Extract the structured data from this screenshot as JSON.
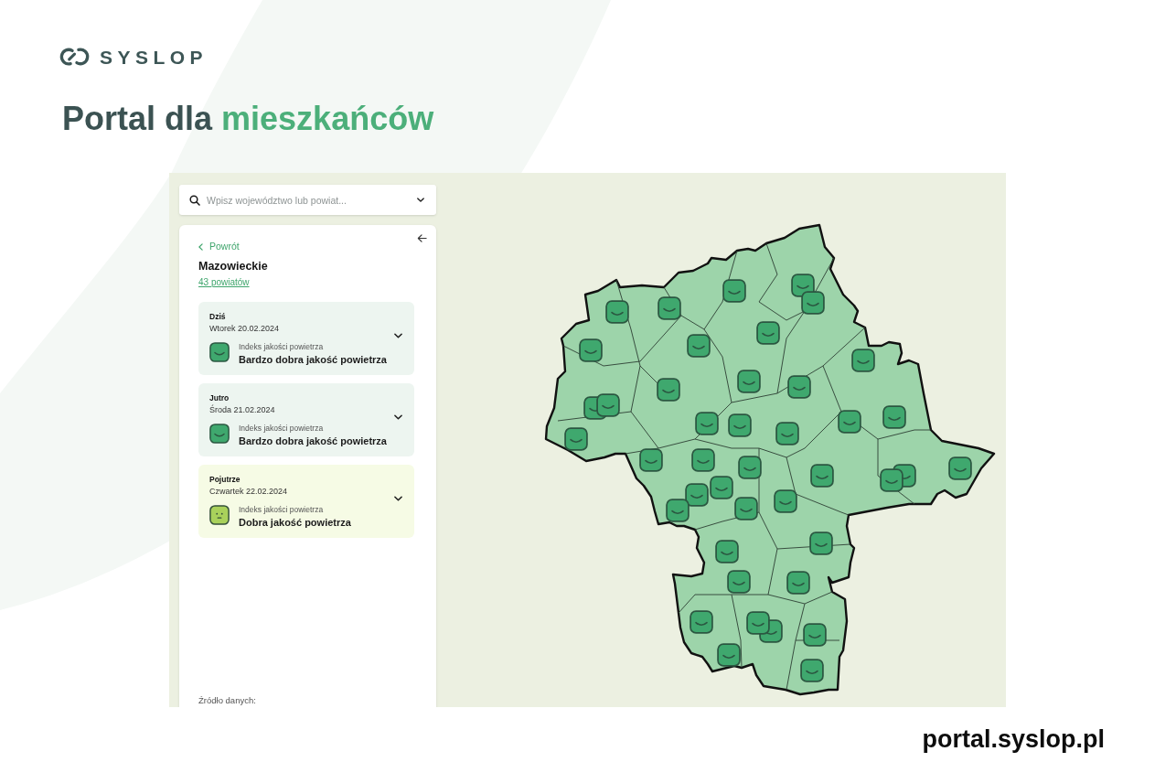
{
  "brand": {
    "name": "SYSLOP"
  },
  "headline": {
    "text": "Portal dla",
    "highlight": "mieszkańców"
  },
  "app": {
    "search": {
      "placeholder": "Wpisz województwo lub powiat..."
    },
    "panel": {
      "back_link": "Powrót",
      "region": "Mazowieckie",
      "districts_link": "43 powiatów",
      "forecasts": [
        {
          "day": "Dziś",
          "date": "Wtorek 20.02.2024",
          "index_label": "Indeks jakości powietrza",
          "quality": "Bardzo dobra jakość powietrza",
          "kind": "very_good",
          "expanded": false
        },
        {
          "day": "Jutro",
          "date": "Środa 21.02.2024",
          "index_label": "Indeks jakości powietrza",
          "quality": "Bardzo dobra jakość powietrza",
          "kind": "very_good",
          "expanded": false
        },
        {
          "day": "Pojutrze",
          "date": "Czwartek 22.02.2024",
          "index_label": "Indeks jakości powietrza",
          "quality": "Dobra jakość powietrza",
          "kind": "good",
          "expanded": false
        }
      ],
      "source_label": "Źródło danych:"
    },
    "map": {
      "markers": [
        {
          "kind": "very_good"
        },
        {
          "kind": "very_good"
        },
        {
          "kind": "very_good"
        },
        {
          "kind": "very_good"
        },
        {
          "kind": "very_good"
        },
        {
          "kind": "very_good"
        },
        {
          "kind": "very_good"
        },
        {
          "kind": "very_good"
        },
        {
          "kind": "very_good"
        },
        {
          "kind": "very_good"
        },
        {
          "kind": "very_good"
        },
        {
          "kind": "very_good"
        },
        {
          "kind": "very_good"
        },
        {
          "kind": "very_good"
        },
        {
          "kind": "very_good"
        },
        {
          "kind": "very_good"
        },
        {
          "kind": "very_good"
        },
        {
          "kind": "very_good"
        },
        {
          "kind": "very_good"
        },
        {
          "kind": "very_good"
        },
        {
          "kind": "very_good"
        },
        {
          "kind": "very_good"
        },
        {
          "kind": "very_good"
        },
        {
          "kind": "very_good"
        },
        {
          "kind": "very_good"
        },
        {
          "kind": "very_good"
        },
        {
          "kind": "very_good"
        },
        {
          "kind": "very_good"
        },
        {
          "kind": "very_good"
        },
        {
          "kind": "very_good"
        },
        {
          "kind": "very_good"
        },
        {
          "kind": "very_good"
        },
        {
          "kind": "very_good"
        },
        {
          "kind": "very_good"
        },
        {
          "kind": "very_good"
        },
        {
          "kind": "very_good"
        },
        {
          "kind": "very_good"
        },
        {
          "kind": "very_good"
        },
        {
          "kind": "very_good"
        },
        {
          "kind": "very_good"
        },
        {
          "kind": "very_good"
        },
        {
          "kind": "very_good"
        }
      ]
    }
  },
  "footer": {
    "url": "portal.syslop.pl"
  }
}
